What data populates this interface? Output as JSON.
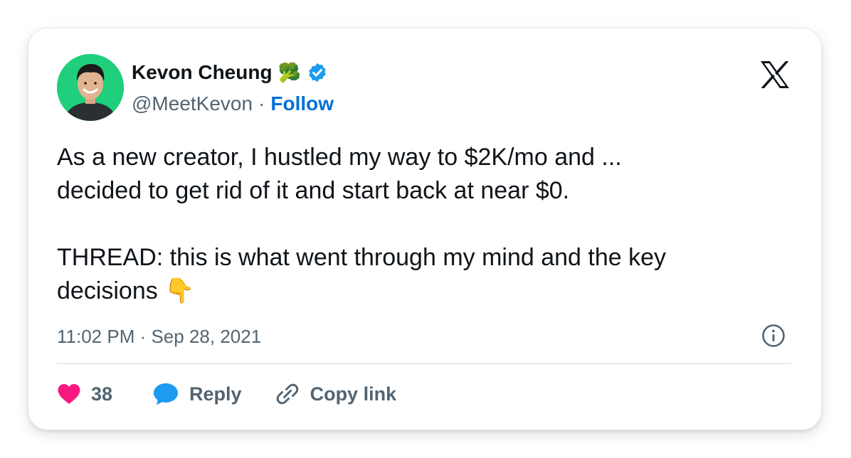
{
  "tweet": {
    "author": {
      "name": "Kevon Cheung",
      "emoji": "🥦",
      "handle": "@MeetKevon",
      "separator": "·",
      "follow_label": "Follow"
    },
    "text": "As a new creator, I hustled my way to $2K/mo and ...\ndecided to get rid of it and start back at near $0.\n\nTHREAD: this is what went through my mind and the key\ndecisions",
    "text_emoji": "👇",
    "timestamp": "11:02 PM · Sep 28, 2021",
    "actions": {
      "like_count": "38",
      "reply_label": "Reply",
      "copy_link_label": "Copy link"
    }
  },
  "colors": {
    "accent": "#006fd6",
    "like": "#f91880",
    "reply": "#1d9bf0",
    "verified": "#1d9bf0",
    "avatar_bg": "#1fcf7c",
    "muted": "#536471"
  },
  "icons": {
    "platform": "x-logo-icon",
    "verified": "verified-badge-icon",
    "info": "info-icon",
    "like": "heart-icon",
    "reply": "speech-bubble-icon",
    "copy_link": "link-icon"
  }
}
